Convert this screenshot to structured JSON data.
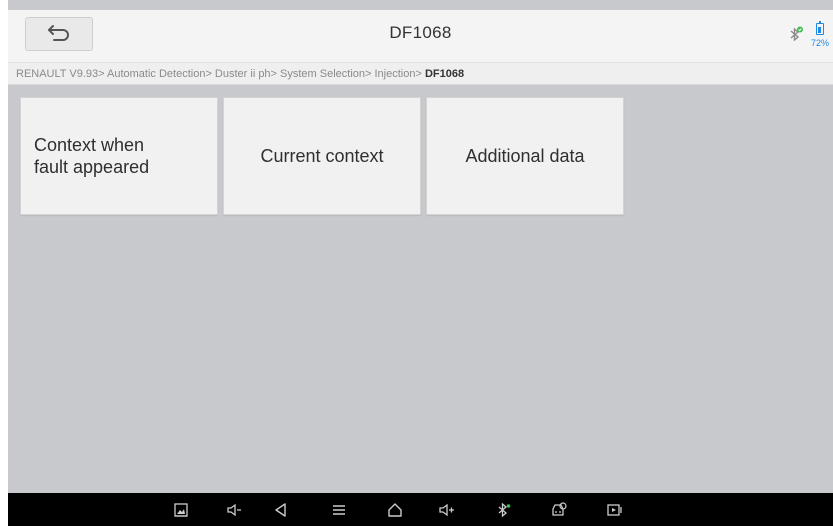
{
  "header": {
    "back_icon": "back-arrow-icon",
    "title": "DF1068",
    "status": {
      "bluetooth_icon": "bluetooth-connected-icon",
      "battery_icon": "battery-icon",
      "battery_percent": "72%",
      "battery_level": 0.72
    }
  },
  "breadcrumb": {
    "path": "RENAULT V9.93> Automatic Detection> Duster ii ph> System Selection> Injection> ",
    "current": "DF1068"
  },
  "tiles": [
    {
      "label": "Context when fault appeared",
      "line1": "Context when",
      "line2": "fault appeared"
    },
    {
      "label": "Current context"
    },
    {
      "label": "Additional data"
    }
  ],
  "navbar": {
    "icons": [
      "screenshot-icon",
      "volume-down-icon",
      "back-icon",
      "menu-icon",
      "home-icon",
      "volume-up-icon",
      "bluetooth-icon",
      "vci-icon",
      "screen-record-icon"
    ],
    "volume_down_label": "-",
    "volume_up_label": "+"
  },
  "colors": {
    "accent": "#1e88e5",
    "bluetooth_ok": "#3cc04a",
    "background": "#c8c9cc",
    "navbar": "#000000"
  }
}
